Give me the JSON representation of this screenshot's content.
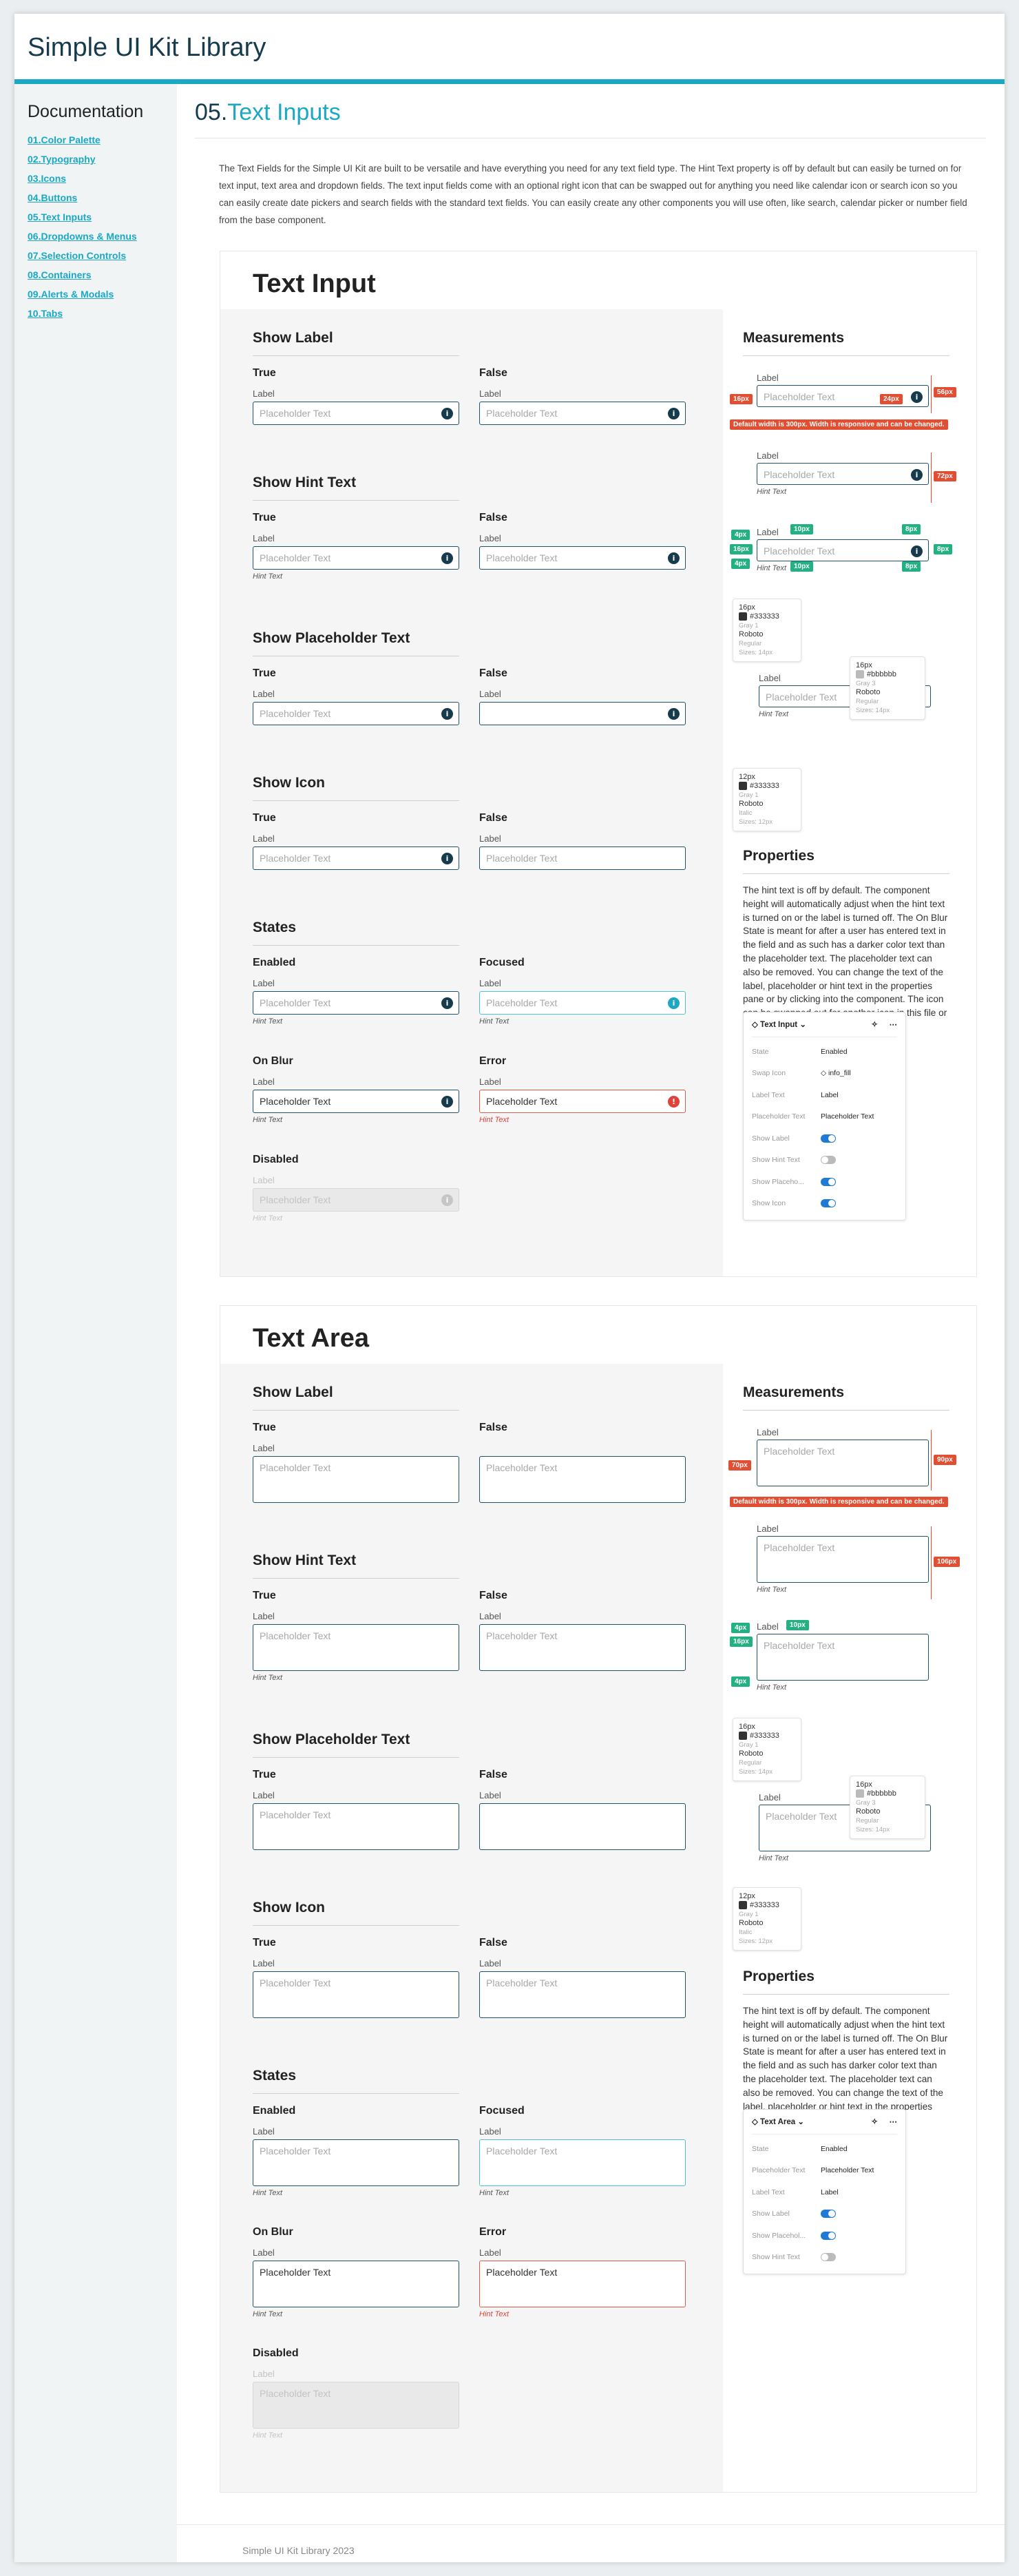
{
  "header": {
    "title": "Simple UI Kit Library"
  },
  "sidebar": {
    "heading": "Documentation",
    "items": [
      "01.Color Palette",
      "02.Typography",
      "03.Icons",
      "04.Buttons",
      "05.Text Inputs",
      "06.Dropdowns & Menus",
      "07.Selection Controls",
      "08.Containers",
      "09.Alerts & Modals",
      "10.Tabs"
    ]
  },
  "page": {
    "num": "05.",
    "title": "Text Inputs",
    "intro": "The Text Fields for the Simple UI Kit are built to be versatile and have everything you need for any text field type. The Hint Text property is off by default but can easily be turned on for text input, text area and dropdown fields. The text input fields come with an optional right icon that can be swapped out for anything you need like calendar icon or search icon so you can easily create date pickers and search fields with the standard text fields. You can easily create any other components you will use often, like search, calendar picker or number field from the base component."
  },
  "common": {
    "true": "True",
    "false": "False",
    "label": "Label",
    "placeholder": "Placeholder Text",
    "hint": "Hint Text",
    "enabled": "Enabled",
    "focused": "Focused",
    "onblur": "On Blur",
    "error": "Error",
    "disabled": "Disabled",
    "info_icon": "i",
    "err_icon": "!"
  },
  "groups": {
    "show_label": "Show Label",
    "show_hint": "Show Hint Text",
    "show_placeholder": "Show Placeholder Text",
    "show_icon": "Show Icon",
    "states": "States"
  },
  "text_input": {
    "title": "Text Input"
  },
  "text_area": {
    "title": "Text Area"
  },
  "measure": {
    "title": "Measurements",
    "note": "Default width is 300px. Width is responsive and can be changed.",
    "b_16": "16px",
    "b_24": "24px",
    "b_56": "56px",
    "b_72": "72px",
    "b_70": "70px",
    "b_90": "90px",
    "b_106": "106px",
    "b_4": "4px",
    "b_10": "10px",
    "b_8": "8px"
  },
  "tips": {
    "size16": "16px",
    "size12": "12px",
    "c333": "#333333",
    "gray1": "Gray 1",
    "cbbb": "#bbbbbb",
    "gray3": "Gray 3",
    "font": "Roboto",
    "regular": "Regular",
    "italic": "Italic",
    "s14": "Sizes: 14px",
    "s12": "Sizes: 12px"
  },
  "props": {
    "title": "Properties",
    "text_ti": "The hint text is off by default. The component height will automatically adjust when the hint text is turned on or the label is turned off. The On Blur State is meant for after a user has entered text in the field and as such has a darker color text than the placeholder text. The placeholder text can also be removed. You can change the text of the label, placeholder or hint text in the properties pane or by clicking into the component. The icon can be swapped out for another icon in this file or any icon library file you are using.",
    "text_ta": "The hint text is off by default. The component height will automatically adjust when the hint text is turned on or the label is turned off. The On Blur State is meant for after a user has entered text in the field and as such has darker color text than the placeholder text. The placeholder text can also be removed. You can change the text of the label, placeholder or hint text in the properties pane or by clicking into the component."
  },
  "panel_ti": {
    "title": "Text Input",
    "rows": [
      {
        "k": "State",
        "v": "Enabled"
      },
      {
        "k": "Swap Icon",
        "v": "info_fill"
      },
      {
        "k": "Label Text",
        "v": "Label"
      },
      {
        "k": "Placeholder Text",
        "v": "Placeholder Text"
      },
      {
        "k": "Show Label",
        "v": "on"
      },
      {
        "k": "Show Hint Text",
        "v": "off"
      },
      {
        "k": "Show Placeho...",
        "v": "on"
      },
      {
        "k": "Show Icon",
        "v": "on"
      }
    ]
  },
  "panel_ta": {
    "title": "Text Area",
    "rows": [
      {
        "k": "State",
        "v": "Enabled"
      },
      {
        "k": "Placeholder Text",
        "v": "Placeholder Text"
      },
      {
        "k": "Label Text",
        "v": "Label"
      },
      {
        "k": "Show Label",
        "v": "on"
      },
      {
        "k": "Show Placehol...",
        "v": "on"
      },
      {
        "k": "Show Hint Text",
        "v": "off"
      }
    ]
  },
  "footer": {
    "text": "Simple UI Kit Library 2023"
  }
}
